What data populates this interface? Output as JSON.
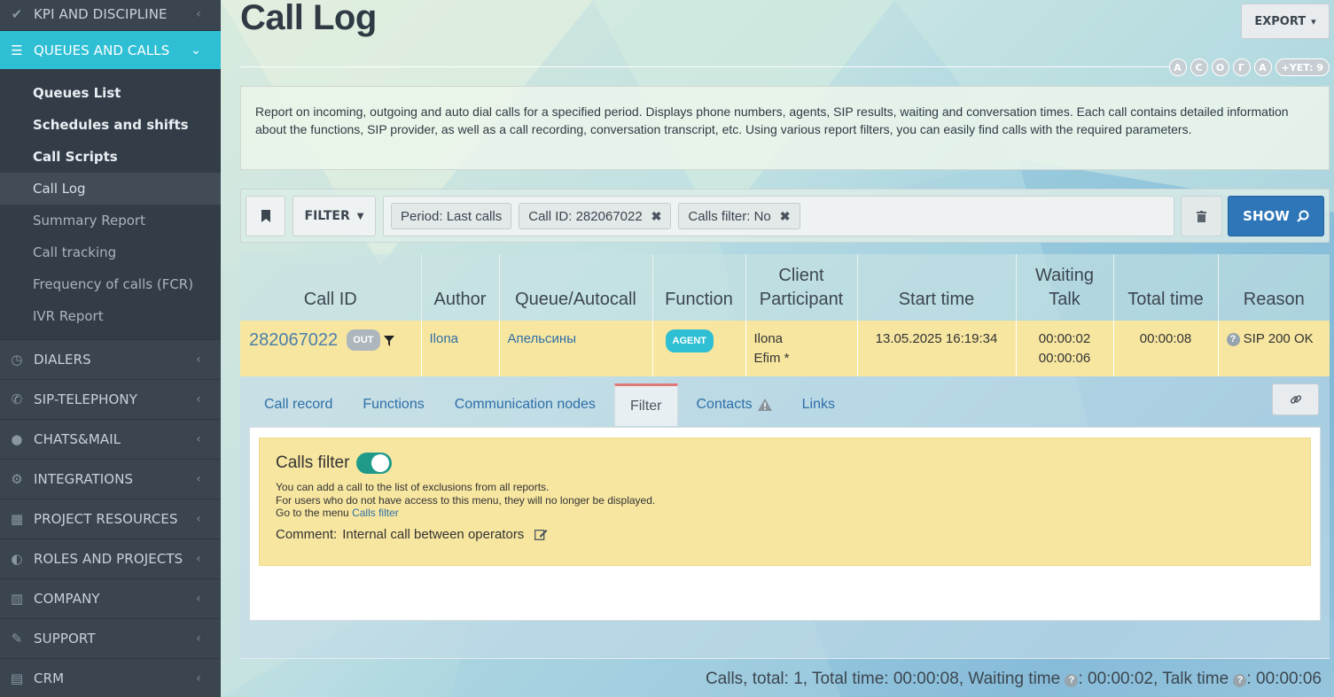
{
  "sidebar": {
    "kpi": "KPI AND DISCIPLINE",
    "queues": "QUEUES AND CALLS",
    "sub_items": [
      "Queues List",
      "Schedules and shifts",
      "Call Scripts",
      "Call Log",
      "Summary Report",
      "Call tracking",
      "Frequency of calls (FCR)",
      "IVR Report"
    ],
    "sections": [
      "DIALERS",
      "SIP-TELEPHONY",
      "CHATS&MAIL",
      "INTEGRATIONS",
      "PROJECT RESOURCES",
      "ROLES AND PROJECTS",
      "COMPANY",
      "SUPPORT",
      "CRM"
    ]
  },
  "header": {
    "title": "Call Log",
    "export_label": "EXPORT",
    "avatars": [
      "А",
      "С",
      "О",
      "Г",
      "А"
    ],
    "avatars_more": "+YET: 9"
  },
  "description": "Report on incoming, outgoing and auto dial calls for a specified period. Displays phone numbers, agents, SIP results, waiting and conversation times. Each call contains detailed information about the functions, SIP provider, as well as a call recording, conversation transcript, etc. Using various report filters, you can easily find calls with the required parameters.",
  "filterbar": {
    "filter_label": "FILTER",
    "chips": [
      "Period: Last calls",
      "Call ID: 282067022",
      "Calls filter: No"
    ],
    "show_label": "SHOW"
  },
  "table": {
    "headers": {
      "call_id": "Call ID",
      "author": "Author",
      "queue": "Queue/Autocall",
      "function": "Function",
      "client_1": "Client",
      "client_2": "Participant",
      "start": "Start time",
      "wait_1": "Waiting",
      "wait_2": "Talk",
      "total": "Total time",
      "reason": "Reason"
    },
    "row": {
      "call_id": "282067022",
      "direction": "OUT",
      "author": "Ilona",
      "queue": "Апельсины",
      "function": "AGENT",
      "client": "Ilona",
      "participant": "Efim *",
      "start": "13.05.2025 16:19:34",
      "waiting": "00:00:02",
      "talk": "00:00:06",
      "total": "00:00:08",
      "reason": "SIP 200 OK"
    }
  },
  "tabs": [
    "Call record",
    "Functions",
    "Communication nodes",
    "Filter",
    "Contacts",
    "Links"
  ],
  "calls_filter": {
    "title": "Calls filter",
    "line1": "You can add a call to the list of exclusions from all reports.",
    "line2": "For users who do not have access to this menu, they will no longer be displayed.",
    "line3_prefix": "Go to the menu",
    "line3_link": "Calls filter",
    "comment_label": "Comment:",
    "comment_value": "Internal call between operators"
  },
  "summary": {
    "part1": "Calls, total: 1, Total time: 00:00:08, Waiting time",
    "part2": ": 00:00:02, Talk time",
    "part3": ": 00:00:06"
  },
  "colors": {
    "accent": "#2fbfd4",
    "primary_button": "#2f76b9",
    "highlight_row": "#f7e6a0",
    "sidebar_bg": "#3a4550"
  }
}
